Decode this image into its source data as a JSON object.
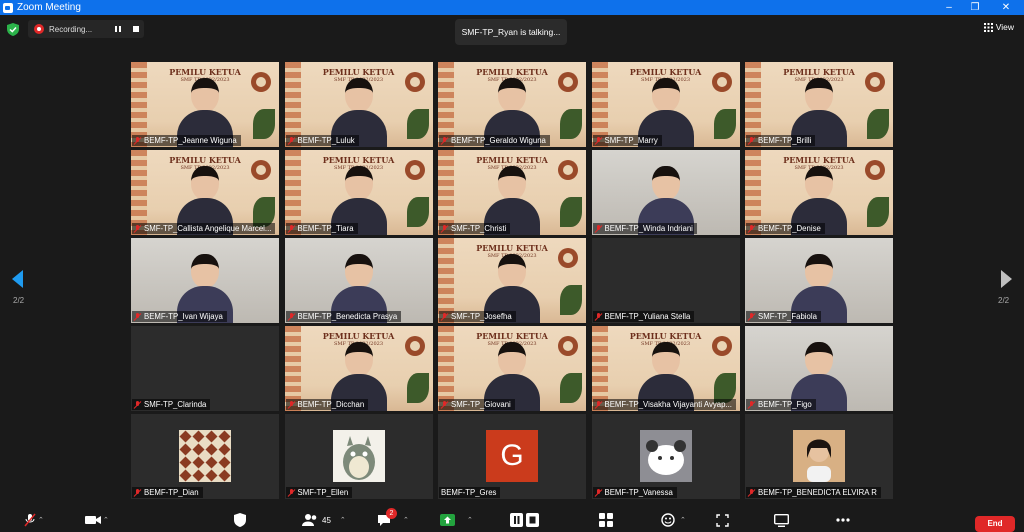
{
  "window": {
    "title": "Zoom Meeting"
  },
  "recording": {
    "label": "Recording..."
  },
  "banner": {
    "talking": "SMF-TP_Ryan is talking..."
  },
  "view_button": {
    "label": "View"
  },
  "pagination": {
    "left": "2/2",
    "right": "2/2"
  },
  "participants": [
    {
      "name": "BEMF-TP_Jeanne Wiguna",
      "muted": true,
      "bg": "poster"
    },
    {
      "name": "BEMF-TP_Luluk",
      "muted": true,
      "bg": "poster"
    },
    {
      "name": "BEMF-TP_Geraldo Wiguna",
      "muted": true,
      "bg": "poster"
    },
    {
      "name": "SMF-TP_Marry",
      "muted": true,
      "bg": "poster"
    },
    {
      "name": "BEMF-TP_Brilli",
      "muted": true,
      "bg": "poster"
    },
    {
      "name": "SMF-TP_Callista Angelique Marcel...",
      "muted": true,
      "bg": "poster"
    },
    {
      "name": "BEMF-TP_Tiara",
      "muted": true,
      "bg": "poster"
    },
    {
      "name": "SMF-TP_Christi",
      "muted": true,
      "bg": "poster"
    },
    {
      "name": "BEMF-TP_Winda Indriani",
      "muted": true,
      "bg": "room"
    },
    {
      "name": "BEMF-TP_Denise",
      "muted": true,
      "bg": "poster"
    },
    {
      "name": "BEMF-TP_Ivan Wijaya",
      "muted": true,
      "bg": "room"
    },
    {
      "name": "BEMF-TP_Benedicta Prasya",
      "muted": true,
      "bg": "room"
    },
    {
      "name": "SMF-TP_Josefha",
      "muted": true,
      "bg": "poster"
    },
    {
      "name": "BEMF-TP_Yuliana Stella",
      "muted": true,
      "bg": "none"
    },
    {
      "name": "SMF-TP_Fabiola",
      "muted": true,
      "bg": "room"
    },
    {
      "name": "SMF-TP_Clarinda",
      "muted": true,
      "bg": "none"
    },
    {
      "name": "BEMF-TP_Dicchan",
      "muted": true,
      "bg": "poster"
    },
    {
      "name": "SMF-TP_Giovani",
      "muted": true,
      "bg": "poster"
    },
    {
      "name": "BEMF-TP_Visakha Vijayanti Avyap...",
      "muted": true,
      "bg": "poster"
    },
    {
      "name": "BEMF-TP_Figo",
      "muted": true,
      "bg": "room"
    },
    {
      "name": "BEMF-TP_Dian",
      "muted": true,
      "bg": "avatar-pattern"
    },
    {
      "name": "SMF-TP_Ellen",
      "muted": true,
      "bg": "avatar-totoro"
    },
    {
      "name": "BEMF-TP_Gres",
      "muted": false,
      "bg": "avatar-letter",
      "avatar_letter": "G"
    },
    {
      "name": "BEMF-TP_Vanessa",
      "muted": true,
      "bg": "avatar-panda"
    },
    {
      "name": "BEMF-TP_BENEDICTA ELVIRA R",
      "muted": true,
      "bg": "avatar-photo"
    }
  ],
  "poster": {
    "title": "PEMILU KETUA",
    "subtitle": "SMF TP 2022/2023"
  },
  "toolbar": {
    "participants_count": "45",
    "chat_badge": "2",
    "end_label": "End"
  },
  "colors": {
    "titlebar": "#0e71eb",
    "end": "#e02828",
    "poster_bg": "#eed9be",
    "share_green": "#23a33e"
  }
}
